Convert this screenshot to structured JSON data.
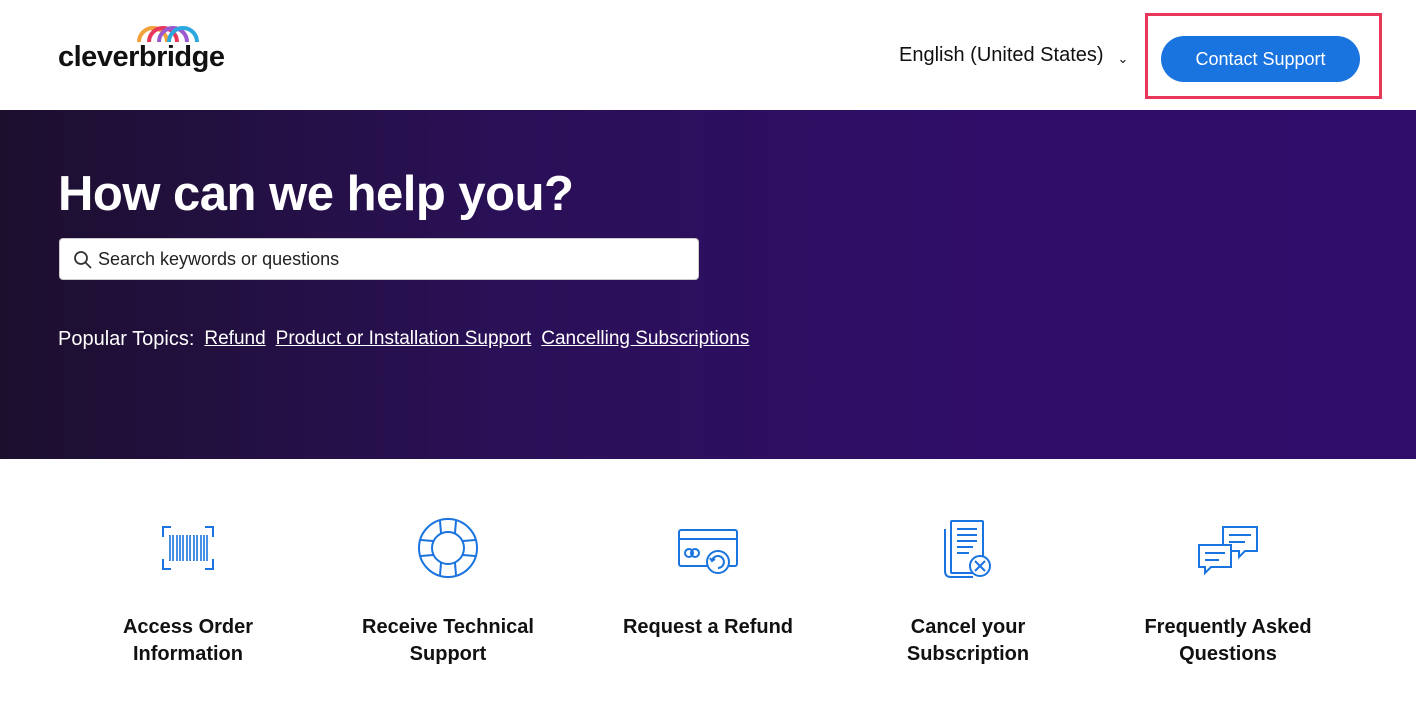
{
  "header": {
    "logo_text": "cleverbridge",
    "language": "English (United States)",
    "contact_label": "Contact Support"
  },
  "hero": {
    "title": "How can we help you?",
    "search_placeholder": "Search keywords or questions",
    "popular_label": "Popular Topics:",
    "popular_topics": [
      "Refund",
      "Product or Installation Support",
      "Cancelling Subscriptions"
    ]
  },
  "cards": [
    {
      "icon": "barcode-icon",
      "label": "Access Order Information"
    },
    {
      "icon": "lifebuoy-icon",
      "label": "Receive Technical Support"
    },
    {
      "icon": "credit-card-refund-icon",
      "label": "Request a Refund"
    },
    {
      "icon": "document-cancel-icon",
      "label": "Cancel your Subscription"
    },
    {
      "icon": "chat-bubbles-icon",
      "label": "Frequently Asked Questions"
    }
  ],
  "colors": {
    "accent": "#1a74e0",
    "hero_start": "#1c0f2e",
    "hero_end": "#300d6a",
    "highlight": "#e8375a",
    "icon": "#1a74e0"
  }
}
